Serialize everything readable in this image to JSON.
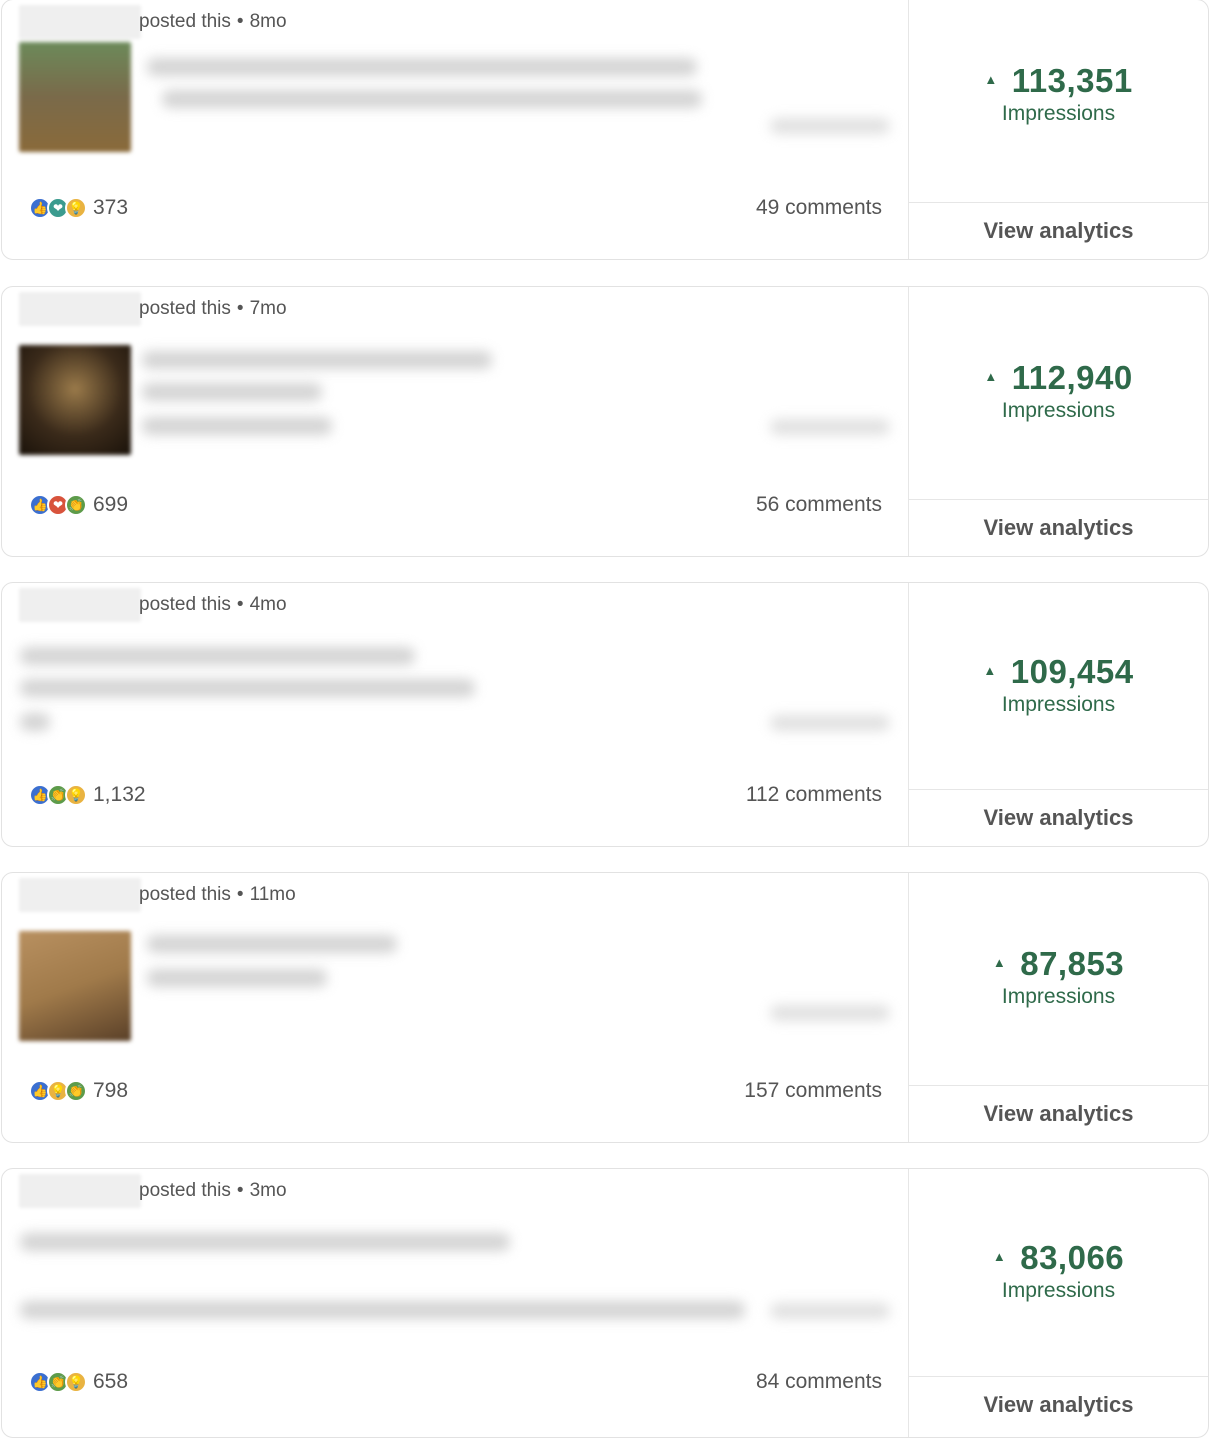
{
  "posts": [
    {
      "meta": "posted this",
      "dot": "•",
      "age": "8mo",
      "reactions_count": "373",
      "reaction_icons": [
        "like-icon",
        "support-icon",
        "insight-icon"
      ],
      "comments": "49 comments",
      "impressions": "113,351",
      "impressions_label": "Impressions",
      "analytics_label": "View analytics",
      "has_thumb": true,
      "thumb_color": "#7a6a4a"
    },
    {
      "meta": "posted this",
      "dot": "•",
      "age": "7mo",
      "reactions_count": "699",
      "reaction_icons": [
        "like-icon",
        "love-icon",
        "celebrate-icon"
      ],
      "comments": "56 comments",
      "impressions": "112,940",
      "impressions_label": "Impressions",
      "analytics_label": "View analytics",
      "has_thumb": true,
      "thumb_color": "#3a2a1a"
    },
    {
      "meta": "posted this",
      "dot": "•",
      "age": "4mo",
      "reactions_count": "1,132",
      "reaction_icons": [
        "like-icon",
        "celebrate-icon",
        "insight-icon"
      ],
      "comments": "112 comments",
      "impressions": "109,454",
      "impressions_label": "Impressions",
      "analytics_label": "View analytics",
      "has_thumb": false,
      "thumb_color": ""
    },
    {
      "meta": "posted this",
      "dot": "•",
      "age": "11mo",
      "reactions_count": "798",
      "reaction_icons": [
        "like-icon",
        "insight-icon",
        "celebrate-icon"
      ],
      "comments": "157 comments",
      "impressions": "87,853",
      "impressions_label": "Impressions",
      "analytics_label": "View analytics",
      "has_thumb": true,
      "thumb_color": "#a07a4a"
    },
    {
      "meta": "posted this",
      "dot": "•",
      "age": "3mo",
      "reactions_count": "658",
      "reaction_icons": [
        "like-icon",
        "celebrate-icon",
        "insight-icon"
      ],
      "comments": "84 comments",
      "impressions": "83,066",
      "impressions_label": "Impressions",
      "analytics_label": "View analytics",
      "has_thumb": false,
      "thumb_color": ""
    }
  ],
  "colors": {
    "accent_green": "#2f6a4a",
    "like_blue": "#3b6fd0",
    "celebrate_green": "#5d9b4a",
    "insight_gold": "#e9b341",
    "love_red": "#d8533c",
    "support_teal": "#3b9b8f"
  }
}
